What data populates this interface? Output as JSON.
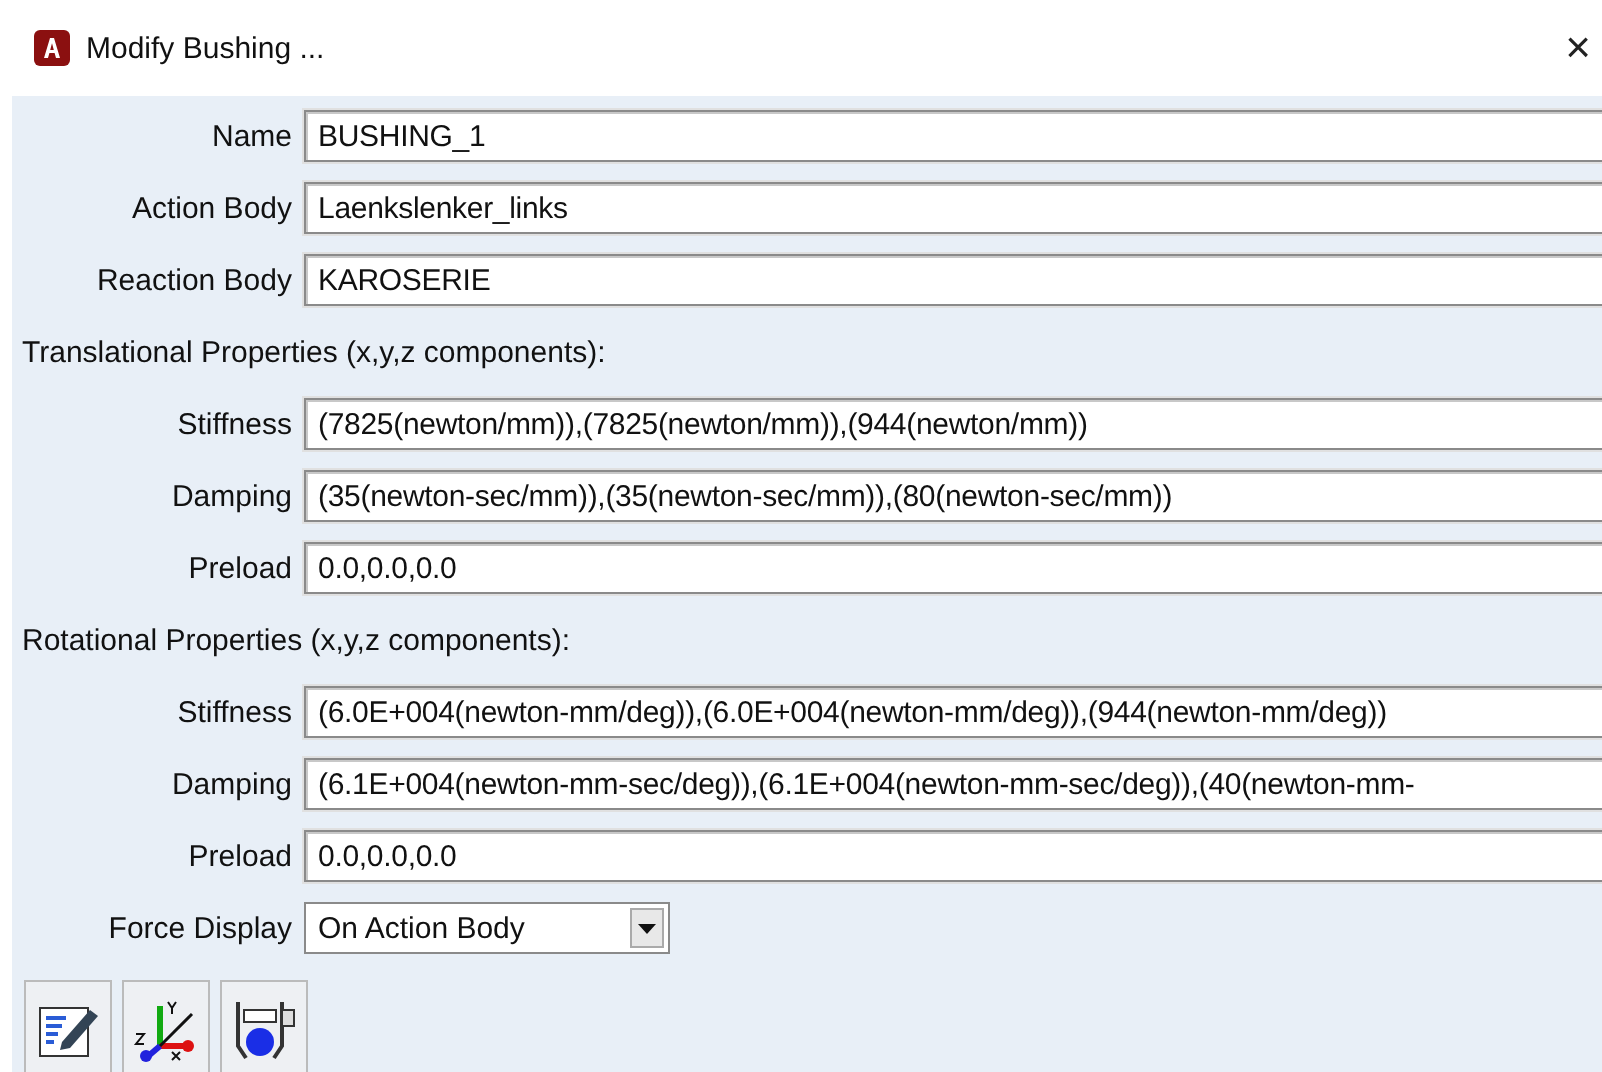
{
  "window": {
    "title": "Modify Bushing ...",
    "close": "×"
  },
  "form": {
    "rows": [
      {
        "kind": "field",
        "label": "Name",
        "value": "BUSHING_1"
      },
      {
        "kind": "field",
        "label": "Action Body",
        "value": "Laenkslenker_links"
      },
      {
        "kind": "field",
        "label": "Reaction Body",
        "value": "KAROSERIE"
      },
      {
        "kind": "heading",
        "label": "Translational Properties (x,y,z components):"
      },
      {
        "kind": "field",
        "label": "Stiffness",
        "value": "(7825(newton/mm)),(7825(newton/mm)),(944(newton/mm))"
      },
      {
        "kind": "field",
        "label": "Damping",
        "value": "(35(newton-sec/mm)),(35(newton-sec/mm)),(80(newton-sec/mm))"
      },
      {
        "kind": "field",
        "label": "Preload",
        "value": "0.0,0.0,0.0"
      },
      {
        "kind": "heading",
        "label": "Rotational Properties (x,y,z components):"
      },
      {
        "kind": "field",
        "label": "Stiffness",
        "value": "(6.0E+004(newton-mm/deg)),(6.0E+004(newton-mm/deg)),(944(newton-mm/deg))"
      },
      {
        "kind": "field",
        "label": "Damping",
        "value": "(6.1E+004(newton-mm-sec/deg)),(6.1E+004(newton-mm-sec/deg)),(40(newton-mm-"
      },
      {
        "kind": "field",
        "label": "Preload",
        "value": "0.0,0.0,0.0"
      },
      {
        "kind": "dropdown",
        "label": "Force Display",
        "value": "On Action Body"
      }
    ]
  },
  "toolbar": [
    {
      "kind": "edit"
    },
    {
      "kind": "axes"
    },
    {
      "kind": "bushing"
    }
  ]
}
